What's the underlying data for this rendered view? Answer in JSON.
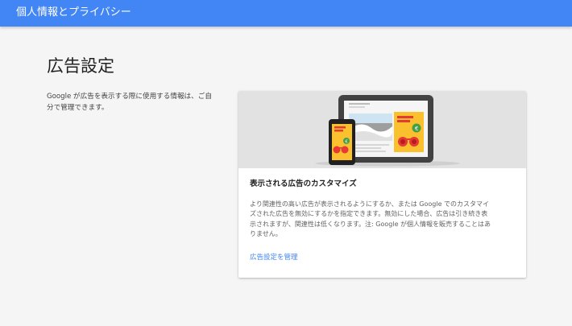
{
  "appbar": {
    "title": "個人情報とプライバシー"
  },
  "page": {
    "title": "広告設定",
    "intro": "Google が広告を表示する際に使用する情報は、ご自分で管理できます。"
  },
  "card": {
    "illustration": "tablet-and-phone-ads-illustration",
    "title": "表示される広告のカスタマイズ",
    "body": "より関連性の高い広告が表示されるようにするか、または Google でのカスタマイズされた広告を無効にするかを指定できます。無効にした場合、広告は引き続き表示されますが、関連性は低くなります。注: Google が個人情報を販売することはありません。",
    "link": "広告設定を管理"
  },
  "colors": {
    "appbar": "#4285f4",
    "link": "#4285f4",
    "ad_yellow": "#fbc02d",
    "ad_red": "#e53935",
    "ad_green": "#43a047"
  }
}
